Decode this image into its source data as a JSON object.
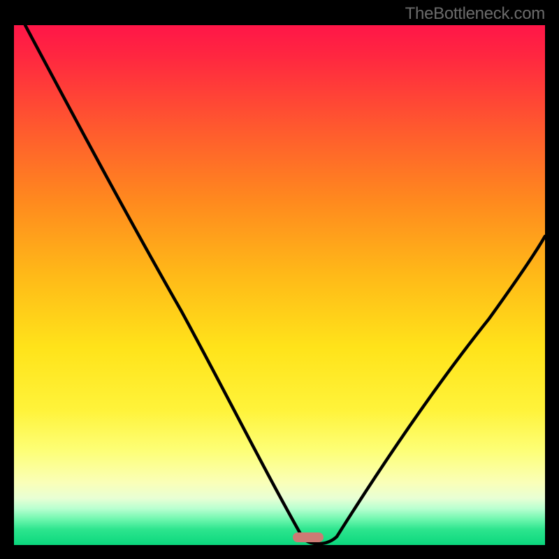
{
  "watermark": "TheBottleneck.com",
  "colors": {
    "background": "#000000",
    "gradient_top": "#ff1648",
    "gradient_bottom": "#0bd77d",
    "curve": "#000000",
    "marker": "#cd7a74"
  },
  "chart_data": {
    "type": "line",
    "title": "",
    "xlabel": "",
    "ylabel": "",
    "ylim": [
      0,
      100
    ],
    "xlim": [
      0,
      100
    ],
    "x": [
      0,
      5,
      10,
      15,
      20,
      25,
      30,
      35,
      40,
      42,
      44,
      46,
      48,
      50,
      52,
      54,
      56,
      57,
      58,
      60,
      62,
      63,
      65,
      68,
      72,
      76,
      80,
      84,
      88,
      92,
      96,
      100
    ],
    "values": [
      100,
      90,
      81,
      73,
      65,
      57,
      50,
      43,
      36,
      33,
      30,
      26,
      22,
      18,
      14,
      10,
      6,
      3,
      1,
      0,
      0,
      1,
      3,
      7,
      13,
      20,
      27,
      34,
      41,
      48,
      55,
      62
    ],
    "marker_x": 59,
    "marker_y": 0
  }
}
